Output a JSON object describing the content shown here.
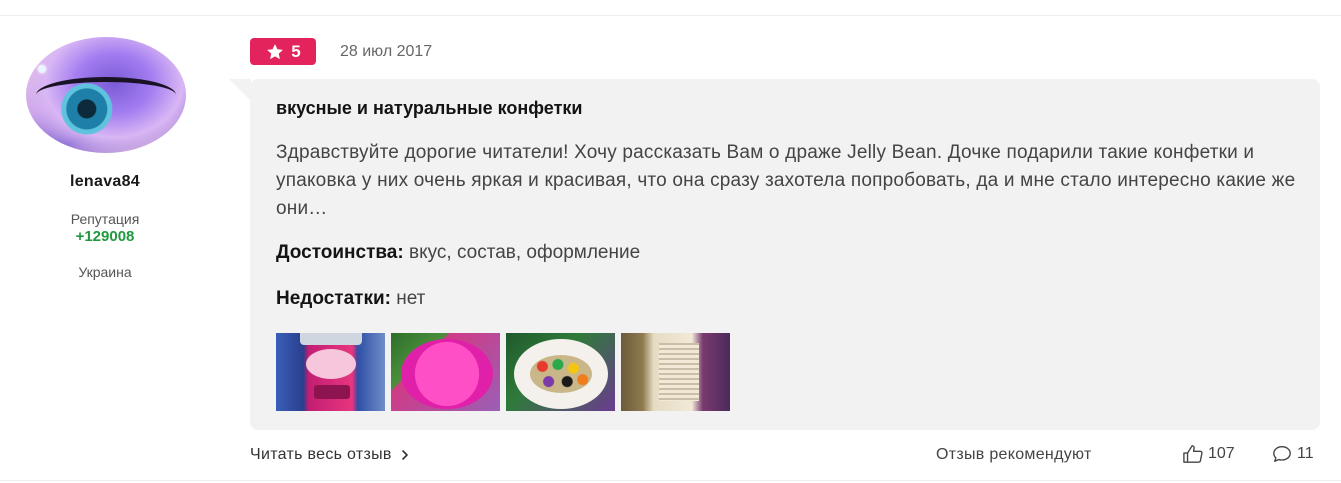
{
  "author": {
    "name": "lenava84",
    "reputation_label": "Репутация",
    "reputation_value": "+129008",
    "country": "Украина"
  },
  "review": {
    "rating": "5",
    "date": "28 июл 2017",
    "title": "вкусные и натуральные конфетки",
    "text": "Здравствуйте дорогие читатели! Хочу рассказать Вам о драже Jelly Bean. Дочке подарили такие конфетки и упаковка у них очень яркая и красивая, что она сразу захотела попробовать, да и мне стало интересно какие же они…",
    "pros_label": "Достоинства:",
    "pros_value": "вкус, состав, оформление",
    "cons_label": "Недостатки:",
    "cons_value": "нет"
  },
  "footer": {
    "read_more": "Читать весь отзыв",
    "recommend_label": "Отзыв рекомендуют",
    "likes": "107",
    "comments": "11"
  },
  "colors": {
    "rating_badge": "#e3245c",
    "reputation": "#1f9a3f",
    "card_bg": "#f2f2f2"
  },
  "icons": [
    "star-icon",
    "chevron-right-icon",
    "thumbs-up-icon",
    "comment-icon"
  ]
}
